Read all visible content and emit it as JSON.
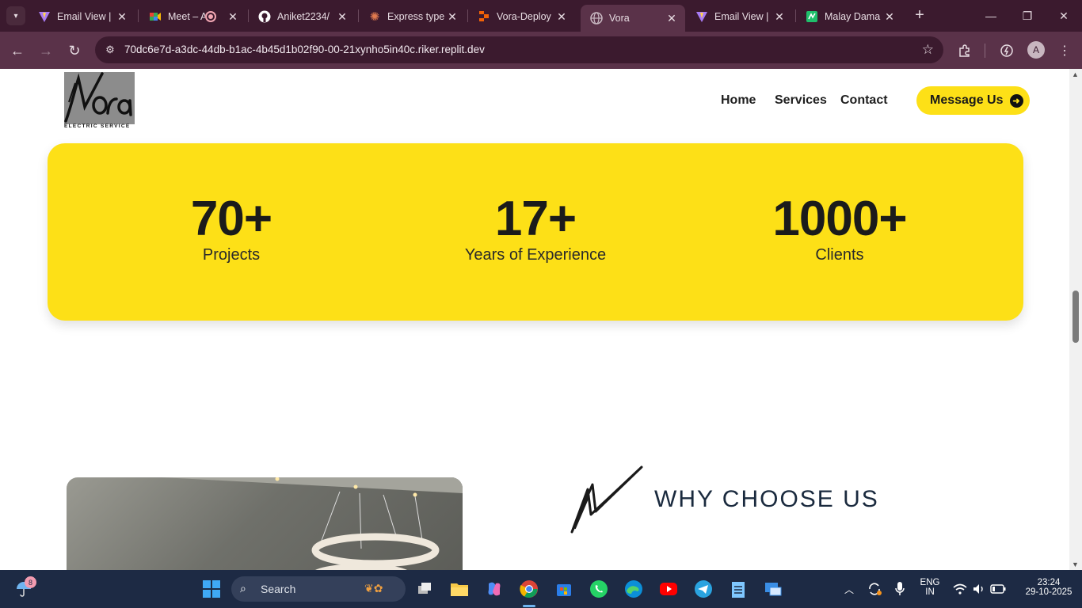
{
  "browser": {
    "tabs": [
      {
        "title": "Email View |",
        "icon": "vite-icon",
        "active": false
      },
      {
        "title": "Meet – A",
        "icon": "google-meet-icon",
        "active": false
      },
      {
        "title": "Aniket2234/",
        "icon": "github-icon",
        "active": false
      },
      {
        "title": "Express type",
        "icon": "claude-icon",
        "active": false
      },
      {
        "title": "Vora-Deploy",
        "icon": "replit-icon",
        "active": false
      },
      {
        "title": "Vora",
        "icon": "globe-icon",
        "active": true
      },
      {
        "title": "Email View |",
        "icon": "vite-icon",
        "active": false
      },
      {
        "title": "Malay Dama",
        "icon": "puzzle-icon",
        "active": false
      }
    ],
    "url": "70dc6e7d-a3dc-44db-b1ac-4b45d1b02f90-00-21xynho5in40c.riker.replit.dev",
    "profile_initial": "A"
  },
  "site": {
    "logo_caption": "ELECTRIC SERVICE",
    "nav": {
      "home": "Home",
      "services": "Services",
      "contact": "Contact"
    },
    "cta_label": "Message Us",
    "stats": [
      {
        "number": "70+",
        "label": "Projects"
      },
      {
        "number": "17+",
        "label": "Years of Experience"
      },
      {
        "number": "1000+",
        "label": "Clients"
      }
    ],
    "why_title": "WHY CHOOSE US"
  },
  "taskbar": {
    "search_placeholder": "Search",
    "weather_badge": "8",
    "lang_line1": "ENG",
    "lang_line2": "IN",
    "time": "23:24",
    "date": "29-10-2025"
  },
  "colors": {
    "accent_yellow": "#fde017",
    "browser_frame": "#3b1a2e",
    "taskbar": "#1d2a44"
  }
}
